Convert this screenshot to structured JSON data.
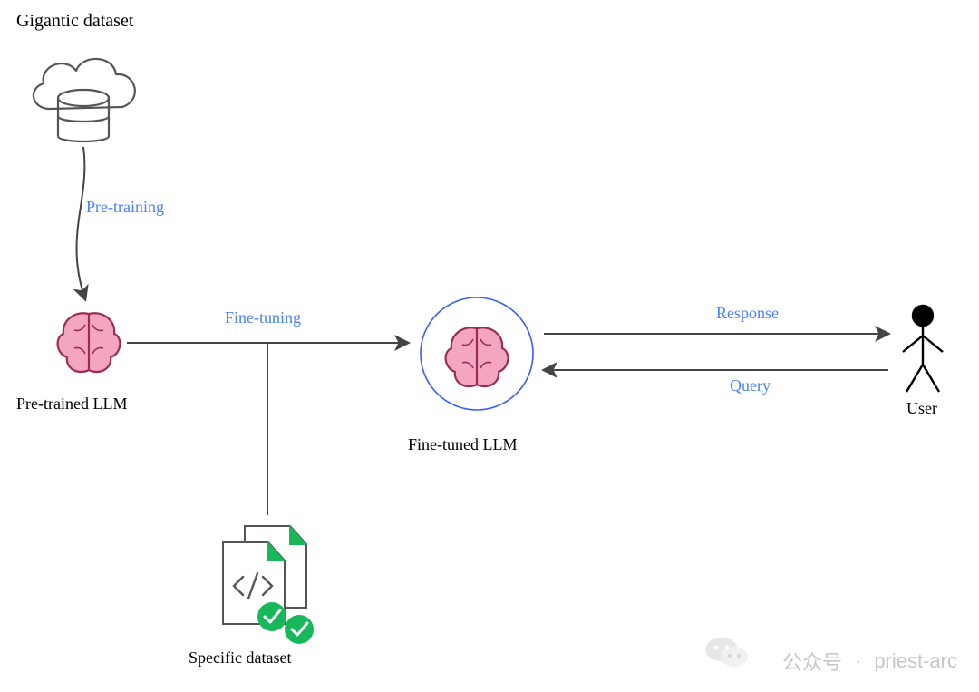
{
  "title_top": "Gigantic dataset",
  "edge_pretraining": "Pre-training",
  "node_pretrained": "Pre-trained LLM",
  "edge_finetuning": "Fine-tuning",
  "node_finetuned": "Fine-tuned LLM",
  "edge_response": "Response",
  "edge_query": "Query",
  "node_user": "User",
  "node_specific": "Specific dataset",
  "watermark_prefix": "公众号",
  "watermark_name": "priest-arc",
  "colors": {
    "blue_text": "#4a80ff",
    "circle_stroke": "#3b5bff",
    "brain_fill": "#f4a6c0",
    "brain_stroke": "#9a2b58",
    "file_green": "#18b85a",
    "arrow_gray": "#444444"
  }
}
